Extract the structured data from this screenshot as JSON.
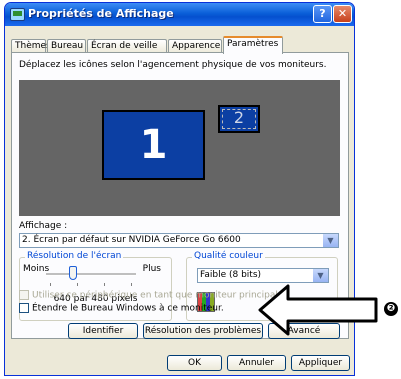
{
  "window": {
    "title": "Propriétés de Affichage",
    "help_label": "?",
    "close_label": "✕",
    "icon": "display-properties-icon"
  },
  "tabs": [
    {
      "label": "Thèmes",
      "active": false
    },
    {
      "label": "Bureau",
      "active": false
    },
    {
      "label": "Écran de veille",
      "active": false
    },
    {
      "label": "Apparence",
      "active": false
    },
    {
      "label": "Paramètres",
      "active": true
    }
  ],
  "settings": {
    "instruction": "Déplacez les icônes selon l'agencement physique de vos moniteurs.",
    "monitor_1": "1",
    "monitor_2": "2",
    "display_label": "Affichage :",
    "display_value": "2. Écran par défaut sur NVIDIA GeForce Go 6600",
    "resolution": {
      "title": "Résolution de l'écran",
      "less": "Moins",
      "more": "Plus",
      "value": "640 par 480 pixels",
      "slider_position_fraction": 0.3
    },
    "color": {
      "title": "Qualité couleur",
      "value": "Faible (8 bits)"
    },
    "use_device_checkbox": "Utiliser ce périphérique en tant que moniteur principal.",
    "extend_checkbox": "Étendre le Bureau Windows à ce moniteur."
  },
  "panel_buttons": {
    "identify": "Identifier",
    "troubleshoot": "Résolution des problèmes",
    "advanced": "Avancé"
  },
  "dialog_buttons": {
    "ok": "OK",
    "cancel": "Annuler",
    "apply": "Appliquer"
  },
  "annotation": {
    "marker": "❷"
  },
  "colors": {
    "titlebar": "#0a5fd8",
    "monitor": "#0c3fa3",
    "preview_bg": "#656565",
    "dialog_bg": "#ece9d8",
    "group_title": "#0046d5"
  }
}
